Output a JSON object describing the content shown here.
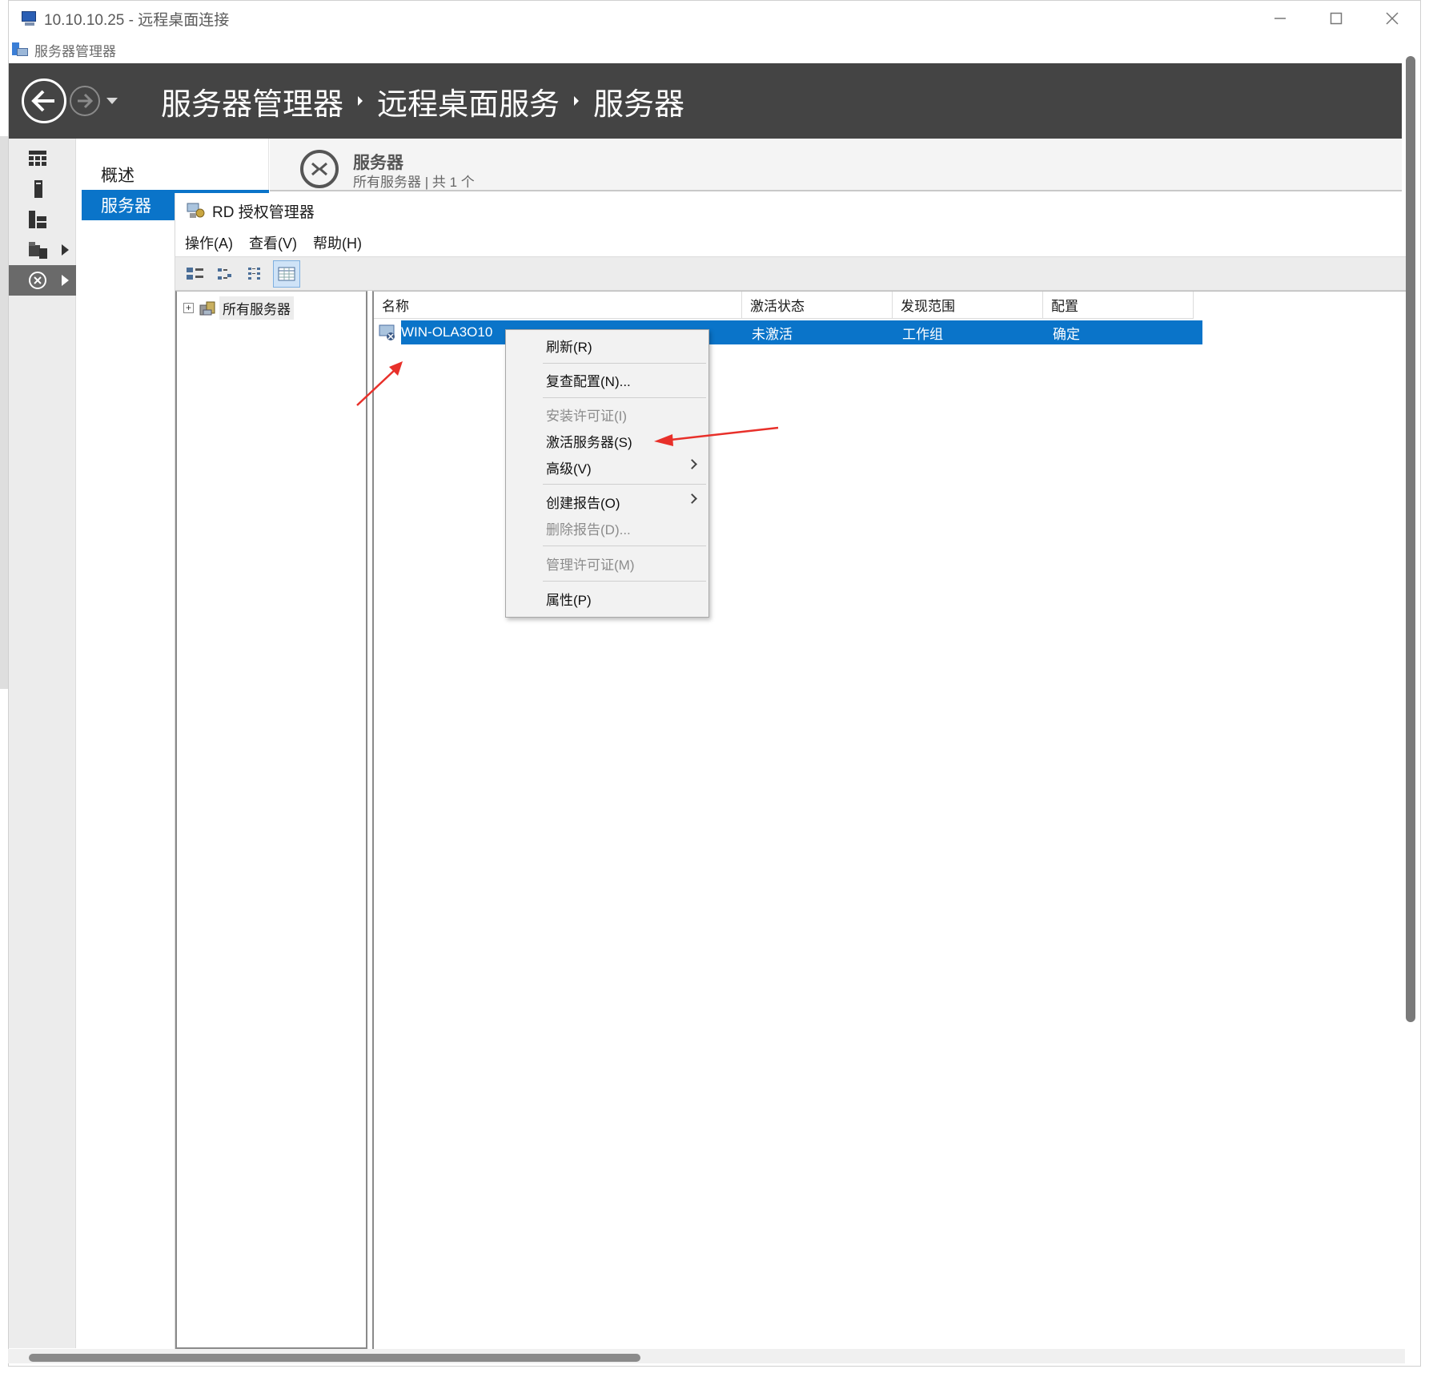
{
  "rdp_window": {
    "title": "10.10.10.25 - 远程桌面连接",
    "controls": [
      "—",
      "☐",
      "✕"
    ]
  },
  "server_manager": {
    "title": "服务器管理器",
    "breadcrumb": [
      "服务器管理器",
      "远程桌面服务",
      "服务器"
    ],
    "nav": [
      "概述",
      "服务器"
    ],
    "selected_nav": "服务器",
    "page_title": "服务器",
    "page_subtitle": "所有服务器 | 共 1 个",
    "rail_icons": [
      "dashboard-icon",
      "local-server-icon",
      "all-servers-icon",
      "file-services-icon",
      "remote-desktop-icon"
    ]
  },
  "rd_license_manager": {
    "title": "RD 授权管理器",
    "menu": [
      "操作(A)",
      "查看(V)",
      "帮助(H)"
    ],
    "toolbar_icons": [
      "large-icons-view-icon",
      "small-icons-view-icon",
      "list-view-icon",
      "details-view-icon"
    ],
    "tree": {
      "root_label": "所有服务器",
      "expander": "+"
    },
    "columns": [
      "名称",
      "激活状态",
      "发现范围",
      "配置"
    ],
    "rows": [
      {
        "name": "WIN-OLA3O10",
        "activation": "未激活",
        "scope": "工作组",
        "config": "确定"
      }
    ]
  },
  "context_menu": {
    "items": [
      {
        "label": "刷新(R)",
        "enabled": true
      },
      {
        "label": "复查配置(N)...",
        "enabled": true
      },
      {
        "label": "安装许可证(I)",
        "enabled": false
      },
      {
        "label": "激活服务器(S)",
        "enabled": true
      },
      {
        "label": "高级(V)",
        "enabled": true,
        "submenu": true
      },
      {
        "label": "创建报告(O)",
        "enabled": true,
        "submenu": true
      },
      {
        "label": "删除报告(D)...",
        "enabled": false
      },
      {
        "label": "管理许可证(M)",
        "enabled": false
      },
      {
        "label": "属性(P)",
        "enabled": true
      }
    ]
  },
  "colors": {
    "header_bg": "#444444",
    "selection": "#0a74c9",
    "annotation_red": "#e8302a"
  }
}
